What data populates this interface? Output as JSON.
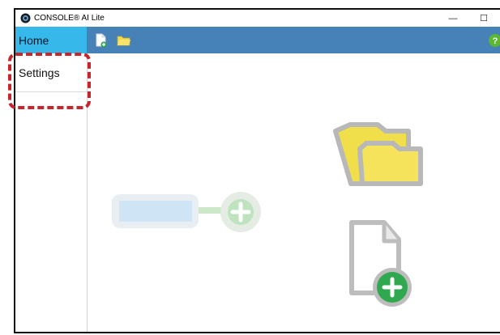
{
  "window": {
    "title": "CONSOLE® AI Lite",
    "minimize_glyph": "—",
    "maximize_glyph": "☐"
  },
  "sidebar": {
    "items": [
      {
        "label": "Home",
        "active": true
      },
      {
        "label": "Settings",
        "active": false
      }
    ]
  },
  "toolbar": {
    "buttons": [
      "new-file-icon",
      "open-folder-icon"
    ],
    "help_glyph": "?"
  },
  "canvas": {
    "icons": [
      "add-input-node-graphic",
      "open-project-folder-icon",
      "new-project-file-icon"
    ]
  },
  "colors": {
    "toolbar": "#4681b8",
    "nav_active": "#36b8ea",
    "highlight": "#c8242b",
    "folder_yellow": "#f6e35a",
    "plus_green": "#2fa84f"
  }
}
